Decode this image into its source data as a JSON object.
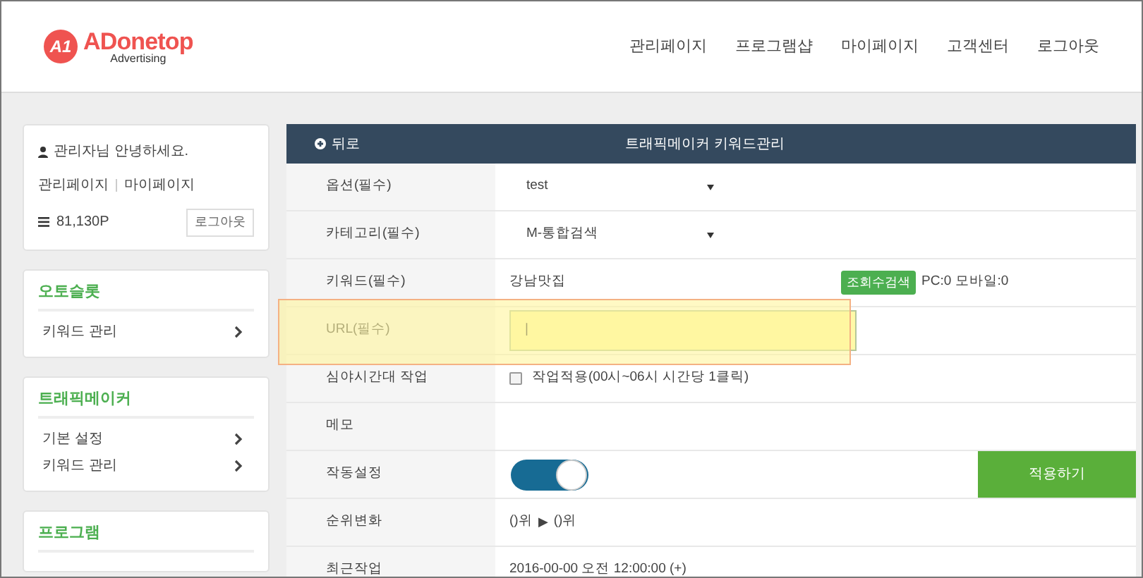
{
  "logo": {
    "badge": "A1",
    "name": "ADonetop",
    "tagline": "Advertising"
  },
  "nav": [
    "관리페이지",
    "프로그램샵",
    "마이페이지",
    "고객센터",
    "로그아웃"
  ],
  "user_card": {
    "greeting": "관리자님 안녕하세요.",
    "links": [
      "관리페이지",
      "마이페이지"
    ],
    "points": "81,130P",
    "logout": "로그아웃"
  },
  "sidebar": [
    {
      "title": "오토슬롯",
      "items": [
        "키워드 관리"
      ]
    },
    {
      "title": "트래픽메이커",
      "items": [
        "기본 설정",
        "키워드 관리"
      ]
    },
    {
      "title": "프로그램"
    }
  ],
  "panel": {
    "back": "뒤로",
    "title": "트래픽메이커 키워드관리"
  },
  "rows": [
    {
      "kind": "select",
      "label": "옵션(필수)",
      "value": "test"
    },
    {
      "kind": "select",
      "label": "카테고리(필수)",
      "value": "M-통합검색"
    },
    {
      "kind": "keyword",
      "label": "키워드(필수)",
      "value": "강남맛집",
      "button": "조회수검색",
      "stats": "PC:0 모바일:0"
    },
    {
      "kind": "input",
      "label": "URL(필수)",
      "value": "|",
      "highlighted": true
    },
    {
      "kind": "checkbox",
      "label": "심야시간대 작업",
      "text": "작업적용(00시~06시 시간당 1클릭)",
      "checked": false
    },
    {
      "kind": "empty",
      "label": "메모"
    },
    {
      "kind": "toggle",
      "label": "작동설정",
      "on": true,
      "button": "적용하기"
    },
    {
      "kind": "rank",
      "label": "순위변화",
      "from": "()위",
      "arrow": "▶",
      "to": "()위"
    },
    {
      "kind": "text",
      "label": "최근작업",
      "value": "2016-00-00 오전 12:00:00 (+)"
    }
  ]
}
